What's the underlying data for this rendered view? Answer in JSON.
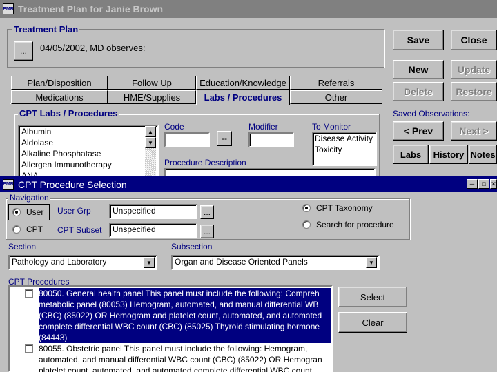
{
  "back_window": {
    "title": "Treatment Plan for Janie Brown",
    "group_label": "Treatment Plan",
    "ellipsis": "...",
    "note": "04/05/2002, MD observes:",
    "tabs_row1": [
      "Plan/Disposition",
      "Follow Up",
      "Education/Knowledge",
      "Referrals"
    ],
    "tabs_row2": [
      "Medications",
      "HME/Supplies",
      "Labs / Procedures",
      "Other"
    ],
    "cpt_group_label": "CPT Labs / Procedures",
    "lab_list": [
      "Albumin",
      "Aldolase",
      "Alkaline Phosphatase",
      "Allergen Immunotherapy",
      "ANA"
    ],
    "code_label": "Code",
    "code_btn": "--",
    "modifier_label": "Modifier",
    "to_monitor_label": "To Monitor",
    "to_monitor_items": [
      "Disease Activity",
      "Toxicity"
    ],
    "procedure_desc_label": "Procedure Description",
    "buttons": {
      "save": "Save",
      "close": "Close",
      "new": "New",
      "update": "Update",
      "delete": "Delete",
      "restore": "Restore",
      "prev": "< Prev",
      "next": "Next >",
      "labs": "Labs",
      "history": "History",
      "notes": "Notes"
    },
    "saved_observations_label": "Saved Observations:"
  },
  "dialog": {
    "title": "CPT Procedure Selection",
    "navigation_label": "Navigation",
    "radio_user": "User",
    "radio_cpt": "CPT",
    "user_grp_label": "User Grp",
    "user_grp_value": "Unspecified",
    "cpt_subset_label": "CPT Subset",
    "cpt_subset_value": "Unspecified",
    "ellipsis": "...",
    "radio_taxonomy": "CPT Taxonomy",
    "radio_search": "Search for procedure",
    "section_label": "Section",
    "section_value": "Pathology and Laboratory",
    "subsection_label": "Subsection",
    "subsection_value": "Organ and Disease Oriented Panels",
    "cpt_procedures_label": "CPT Procedures",
    "select_button": "Select",
    "clear_button": "Clear",
    "procedures": [
      {
        "lines": [
          "80050. General health panel This panel must include the following: Compreh",
          "metabolic panel (80053) Hemogram, automated, and manual differential WB",
          "(CBC) (85022) OR Hemogram and platelet count, automated, and automated",
          "complete differential WBC count (CBC) (85025) Thyroid stimulating hormone",
          "(84443)"
        ],
        "selected": true
      },
      {
        "lines": [
          "80055. Obstetric panel This panel must include the following: Hemogram,",
          "automated, and manual differential WBC count (CBC) (85022) OR Hemogran",
          "platelet count, automated, and automated complete differential WBC count"
        ],
        "selected": false
      }
    ]
  },
  "colors": {
    "active_title": "#000080",
    "inactive_title": "#808080",
    "face": "#c0c0c0",
    "label_blue": "#000080"
  },
  "icons": [
    "app-icon",
    "dropdown-arrow-icon",
    "minimize-icon",
    "maximize-icon",
    "close-icon",
    "scroll-up-icon",
    "scroll-down-icon"
  ]
}
